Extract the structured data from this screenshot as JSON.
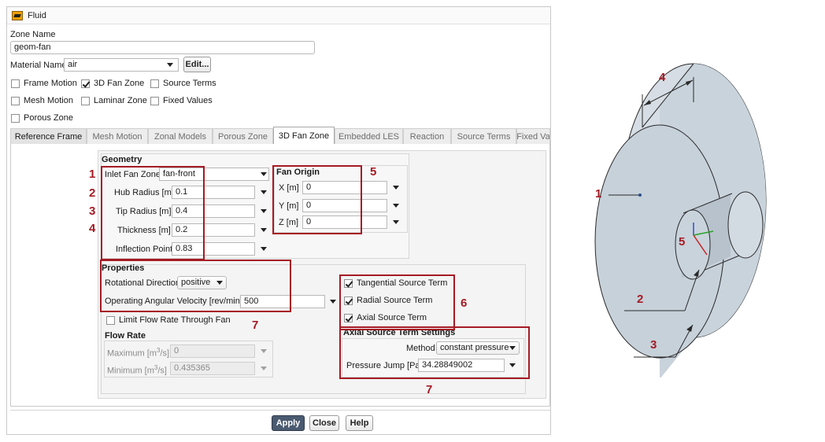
{
  "window": {
    "title": "Fluid"
  },
  "zone": {
    "label": "Zone Name",
    "value": "geom-fan"
  },
  "material": {
    "label": "Material Name",
    "value": "air",
    "edit_label": "Edit..."
  },
  "options": {
    "frame_motion": "Frame Motion",
    "fan_zone_3d": "3D Fan Zone",
    "source_terms": "Source Terms",
    "mesh_motion": "Mesh Motion",
    "laminar_zone": "Laminar Zone",
    "fixed_values": "Fixed Values",
    "porous_zone": "Porous Zone"
  },
  "tabs": [
    "Reference Frame",
    "Mesh Motion",
    "Zonal Models",
    "Porous Zone",
    "3D Fan Zone",
    "Embedded LES",
    "Reaction",
    "Source Terms",
    "Fixed Va"
  ],
  "geometry": {
    "title": "Geometry",
    "inlet_label": "Inlet Fan Zone",
    "inlet_value": "fan-front",
    "hub_label": "Hub Radius [m]",
    "hub_value": "0.1",
    "tip_label": "Tip Radius [m]",
    "tip_value": "0.4",
    "thickness_label": "Thickness [m]",
    "thickness_value": "0.2",
    "inflection_label": "Inflection Point",
    "inflection_value": "0.83"
  },
  "origin": {
    "title": "Fan Origin",
    "x_label": "X [m]",
    "x_value": "0",
    "y_label": "Y [m]",
    "y_value": "0",
    "z_label": "Z [m]",
    "z_value": "0"
  },
  "properties": {
    "title": "Properties",
    "rot_label": "Rotational Direction",
    "rot_value": "positive",
    "omega_label": "Operating Angular Velocity [rev/min]",
    "omega_value": "500",
    "limit_label": "Limit Flow Rate Through Fan"
  },
  "source": {
    "tangential": "Tangential Source Term",
    "radial": "Radial Source Term",
    "axial": "Axial Source Term"
  },
  "flow_rate": {
    "title": "Flow Rate",
    "max_label": "Maximum [m",
    "max_unit": "/s]",
    "max_value": "0",
    "min_label": "Minimum [m",
    "min_unit": "/s]",
    "min_value": "0.435365",
    "exp": "3"
  },
  "axial_settings": {
    "title": "Axial Source Term Settings",
    "method_label": "Method",
    "method_value": "constant pressure",
    "jump_label": "Pressure Jump [Pa]",
    "jump_value": "34.28849002"
  },
  "buttons": {
    "apply": "Apply",
    "close": "Close",
    "help": "Help"
  },
  "callouts": {
    "n1": "1",
    "n2": "2",
    "n3": "3",
    "n4": "4",
    "n5": "5",
    "n6": "6",
    "n7": "7"
  },
  "colors": {
    "callout_red": "#a51b24",
    "cylinder": "#c9d3dc",
    "apply_bg": "#4a5a70"
  }
}
